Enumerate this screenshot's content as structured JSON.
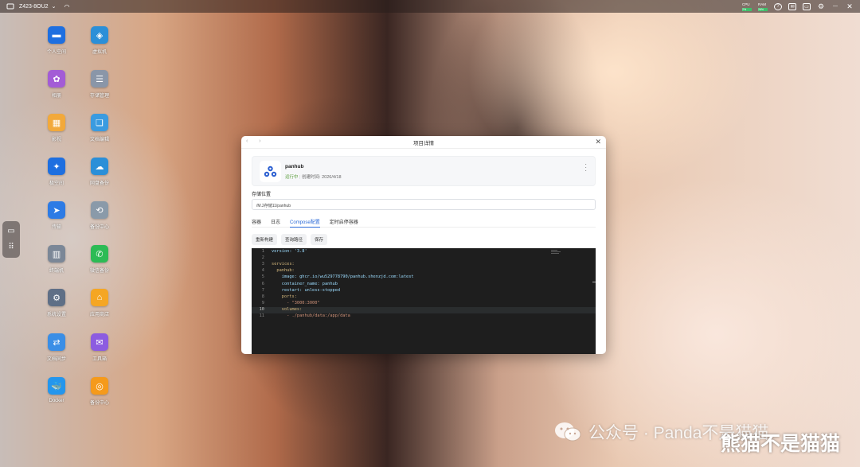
{
  "topbar": {
    "device_name": "Z423-8OU2",
    "stats": [
      {
        "label": "CPU",
        "value": "2%"
      },
      {
        "label": "RAM",
        "value": "26%"
      }
    ],
    "icons": [
      "help-icon",
      "mail-icon",
      "screen-icon",
      "settings-icon",
      "minimize-icon",
      "close-icon"
    ]
  },
  "dock": {
    "icons": [
      "message-icon",
      "apps-grid-icon"
    ]
  },
  "desktop": {
    "icons": [
      {
        "label": "个人空间",
        "color": "#1e6fe0",
        "glyph": "▬",
        "name": "personal-space"
      },
      {
        "label": "虚拟机",
        "color": "#2b8fd8",
        "glyph": "◈",
        "name": "virtual-machine"
      },
      {
        "label": "相册",
        "color": "#a35cd6",
        "glyph": "✿",
        "name": "photos"
      },
      {
        "label": "存储管理",
        "color": "#8a96a8",
        "glyph": "☰",
        "name": "storage-manager"
      },
      {
        "label": "影视",
        "color": "#f2a93b",
        "glyph": "▦",
        "name": "video"
      },
      {
        "label": "文档编辑",
        "color": "#3a9be0",
        "glyph": "❏",
        "name": "document-editor"
      },
      {
        "label": "极空间",
        "color": "#1e6fe0",
        "glyph": "✦",
        "name": "zspace"
      },
      {
        "label": "网盘备份",
        "color": "#2b8fd8",
        "glyph": "☁",
        "name": "cloud-backup"
      },
      {
        "label": "传输",
        "color": "#2d7be5",
        "glyph": "➤",
        "name": "transfer"
      },
      {
        "label": "备份中心",
        "color": "#8a9aa9",
        "glyph": "⟲",
        "name": "backup-center"
      },
      {
        "label": "终端机",
        "color": "#7b8797",
        "glyph": "▥",
        "name": "terminal"
      },
      {
        "label": "微信备份",
        "color": "#2cbb55",
        "glyph": "✆",
        "name": "wechat-backup"
      },
      {
        "label": "系统设置",
        "color": "#5f6f86",
        "glyph": "⚙",
        "name": "system-settings"
      },
      {
        "label": "应用商店",
        "color": "#f5a623",
        "glyph": "⌂",
        "name": "app-store"
      },
      {
        "label": "文档同步",
        "color": "#3a8ee6",
        "glyph": "⇄",
        "name": "doc-sync"
      },
      {
        "label": "工具箱",
        "color": "#8c5ce0",
        "glyph": "✉",
        "name": "toolbox"
      },
      {
        "label": "Docker",
        "color": "#2496ed",
        "glyph": "🐳",
        "name": "docker"
      },
      {
        "label": "备份中心",
        "color": "#f59a1b",
        "glyph": "◎",
        "name": "backup-hub"
      }
    ]
  },
  "window": {
    "title": "项目详情",
    "project": {
      "name": "panhub",
      "status": "运行中",
      "created_label": "创建时间:",
      "created": "2026/4/18"
    },
    "storage_label": "存储位置",
    "storage_path": "/M.2存储11/panhub",
    "tabs": [
      {
        "label": "容器",
        "active": false
      },
      {
        "label": "日志",
        "active": false
      },
      {
        "label": "Compose配置",
        "active": true
      },
      {
        "label": "定时启停容器",
        "active": false
      }
    ],
    "buttons": [
      "重新构建",
      "查询路径",
      "保存"
    ],
    "code": [
      {
        "n": "1",
        "text": "version: '3.8'"
      },
      {
        "n": "2",
        "text": ""
      },
      {
        "n": "3",
        "text": "services:"
      },
      {
        "n": "4",
        "text": "  panhub:"
      },
      {
        "n": "5",
        "text": "    image: ghcr.io/wu529778790/panhub.shenzjd.com:latest"
      },
      {
        "n": "6",
        "text": "    container_name: panhub"
      },
      {
        "n": "7",
        "text": "    restart: unless-stopped"
      },
      {
        "n": "8",
        "text": "    ports:"
      },
      {
        "n": "9",
        "text": "      - \"3000:3000\""
      },
      {
        "n": "10",
        "text": "    volumes:"
      },
      {
        "n": "11",
        "text": "      - ./panhub/data:/app/data"
      }
    ]
  },
  "watermark": {
    "text": "公众号 · Panda不是猫猫",
    "overlay": "熊猫不是猫猫"
  }
}
